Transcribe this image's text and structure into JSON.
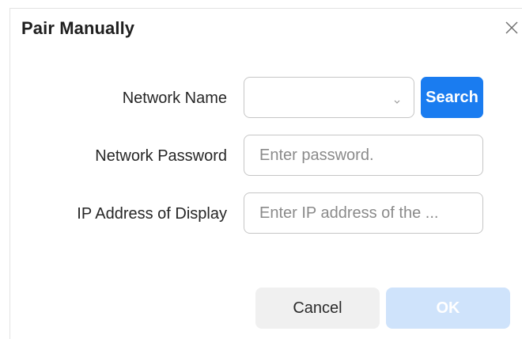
{
  "dialog": {
    "title": "Pair Manually",
    "close_icon": "close-icon"
  },
  "form": {
    "network_name": {
      "label": "Network Name",
      "value": "",
      "dropdown_icon": "chevron-down-icon"
    },
    "search_label": "Search",
    "network_password": {
      "label": "Network Password",
      "value": "",
      "placeholder": "Enter password."
    },
    "ip_address": {
      "label": "IP Address of Display",
      "value": "",
      "placeholder": "Enter IP address of the ..."
    }
  },
  "footer": {
    "cancel_label": "Cancel",
    "ok_label": "OK",
    "ok_enabled": false
  },
  "colors": {
    "accent": "#1a7cf0",
    "ok_disabled_bg": "#cfe3fb",
    "cancel_bg": "#f0f0f0"
  }
}
